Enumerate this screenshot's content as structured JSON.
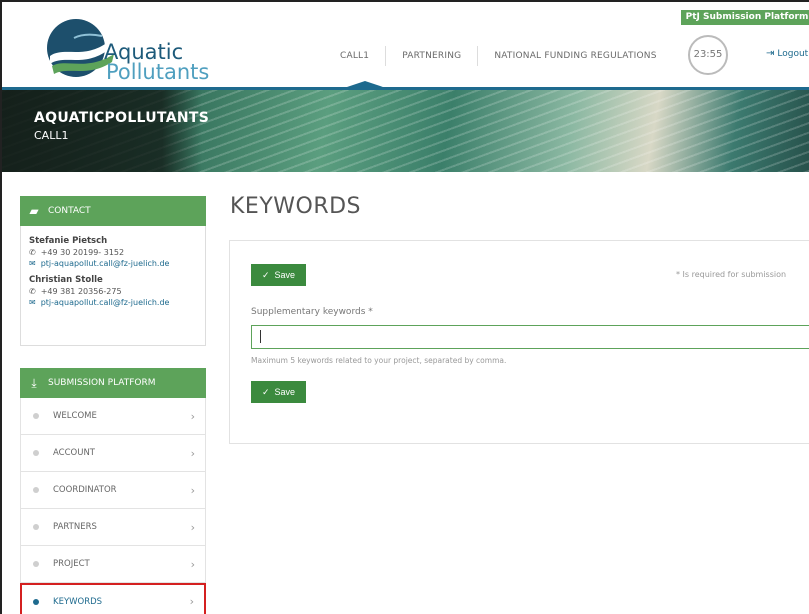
{
  "header": {
    "platform_badge": "PtJ Submission Platform",
    "logo_line1": "Aquatic",
    "logo_line2": "Pollutants",
    "nav": [
      {
        "label": "CALL1"
      },
      {
        "label": "PARTNERING"
      },
      {
        "label": "NATIONAL FUNDING REGULATIONS"
      }
    ],
    "timer": "23:55",
    "logout_label": "Logout",
    "logout_icon": "logout-icon"
  },
  "banner": {
    "title": "AQUATICPOLLUTANTS",
    "subtitle": "CALL1"
  },
  "sidebar": {
    "contact_title": "CONTACT",
    "contact_icon": "chat-icon",
    "contacts": [
      {
        "name": "Stefanie Pietsch",
        "phone": "+49 30 20199- 3152",
        "email": "ptj-aquapollut.call@fz-juelich.de"
      },
      {
        "name": "Christian Stolle",
        "phone": "+49 381 20356-275",
        "email": "ptj-aquapollut.call@fz-juelich.de"
      }
    ],
    "submission_title": "SUBMISSION PLATFORM",
    "submission_icon": "download-icon",
    "items": [
      {
        "label": "WELCOME"
      },
      {
        "label": "ACCOUNT"
      },
      {
        "label": "COORDINATOR"
      },
      {
        "label": "PARTNERS"
      },
      {
        "label": "PROJECT"
      },
      {
        "label": "KEYWORDS",
        "active": true
      }
    ]
  },
  "main": {
    "title": "KEYWORDS",
    "save_label": "Save",
    "required_note": "* Is required for submission",
    "field_label": "Supplementary keywords *",
    "field_value": "",
    "field_help": "Maximum 5 keywords related to your project, separated by comma."
  },
  "colors": {
    "accent_green": "#5da35a",
    "button_green": "#3b8a3e",
    "brand_blue": "#1e6a8e",
    "active_outline": "#d42020"
  }
}
